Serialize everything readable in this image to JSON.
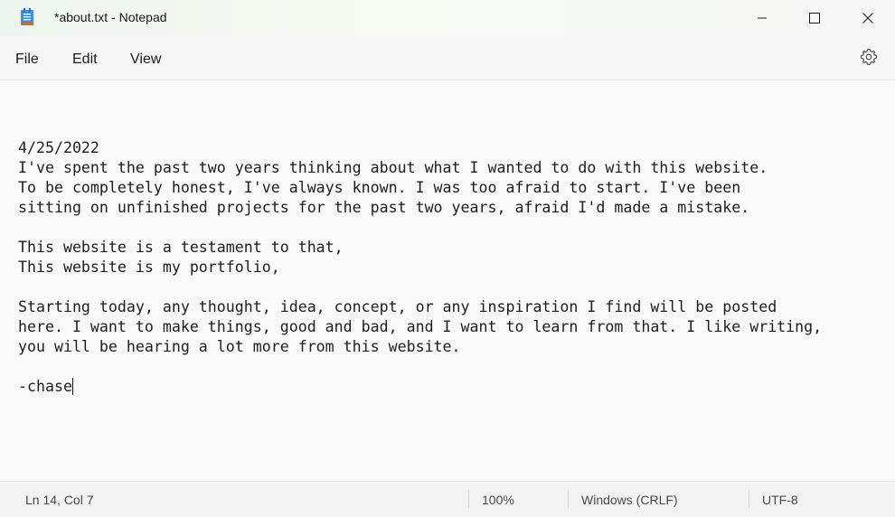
{
  "window": {
    "title": "*about.txt - Notepad"
  },
  "menu": {
    "items": [
      {
        "label": "File"
      },
      {
        "label": "Edit"
      },
      {
        "label": "View"
      }
    ]
  },
  "icons": {
    "app": "notepad-icon",
    "minimize": "minimize-icon",
    "maximize": "maximize-icon",
    "close": "close-icon",
    "settings": "gear-icon"
  },
  "document": {
    "lines": [
      "",
      "4/25/2022",
      "I've spent the past two years thinking about what I wanted to do with this website.",
      "To be completely honest, I've always known. I was too afraid to start. I've been",
      "sitting on unfinished projects for the past two years, afraid I'd made a mistake.",
      "",
      "This website is a testament to that,",
      "This website is my portfolio,",
      "",
      "Starting today, any thought, idea, concept, or any inspiration I find will be posted",
      "here. I want to make things, good and bad, and I want to learn from that. I like writing,",
      "you will be hearing a lot more from this website.",
      "",
      "-chase"
    ]
  },
  "status": {
    "position": "Ln 14, Col 7",
    "zoom": "100%",
    "line_ending": "Windows (CRLF)",
    "encoding": "UTF-8"
  },
  "colors": {
    "accent": "#2b6cc4",
    "text": "#1e1e1e"
  }
}
